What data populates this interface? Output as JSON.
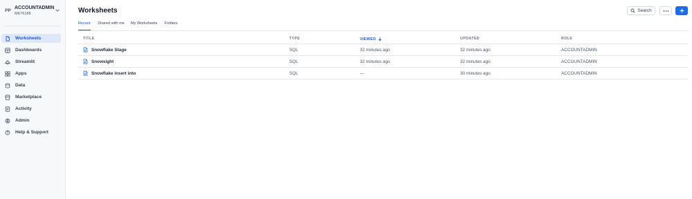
{
  "account": {
    "initials": "PP",
    "name": "ACCOUNTADMIN",
    "id": "MK76188"
  },
  "sidebar": {
    "items": [
      {
        "label": "Worksheets",
        "icon": "document-icon",
        "active": true
      },
      {
        "label": "Dashboards",
        "icon": "dashboard-icon",
        "active": false
      },
      {
        "label": "Streamlit",
        "icon": "streamlit-icon",
        "active": false
      },
      {
        "label": "Apps",
        "icon": "apps-icon",
        "active": false
      },
      {
        "label": "Data",
        "icon": "database-icon",
        "active": false
      },
      {
        "label": "Marketplace",
        "icon": "marketplace-icon",
        "active": false
      },
      {
        "label": "Activity",
        "icon": "activity-icon",
        "active": false
      },
      {
        "label": "Admin",
        "icon": "shield-icon",
        "active": false
      },
      {
        "label": "Help & Support",
        "icon": "help-icon",
        "active": false
      }
    ]
  },
  "header": {
    "title": "Worksheets",
    "search_label": "Search"
  },
  "tabs": [
    {
      "label": "Recent",
      "active": true
    },
    {
      "label": "Shared with me",
      "active": false
    },
    {
      "label": "My Worksheets",
      "active": false
    },
    {
      "label": "Folders",
      "active": false
    }
  ],
  "table": {
    "columns": [
      "TITLE",
      "TYPE",
      "VIEWED",
      "UPDATED",
      "ROLE"
    ],
    "sorted_column": "VIEWED",
    "sort_direction": "descending",
    "rows": [
      {
        "title": "Snowflake Stage",
        "type": "SQL",
        "viewed": "32 minutes ago",
        "updated": "32 minutes ago",
        "role": "ACCOUNTADMIN"
      },
      {
        "title": "Snowsight",
        "type": "SQL",
        "viewed": "32 minutes ago",
        "updated": "32 minutes ago",
        "role": "ACCOUNTADMIN"
      },
      {
        "title": "Snowflake insert into",
        "type": "SQL",
        "viewed": "—",
        "updated": "30 minutes ago",
        "role": "ACCOUNTADMIN"
      }
    ]
  },
  "colors": {
    "accent": "#1a56db",
    "primary_button": "#1a6ce8",
    "active_nav_bg": "#dde8fb",
    "sidebar_bg": "#f7f8fa"
  }
}
